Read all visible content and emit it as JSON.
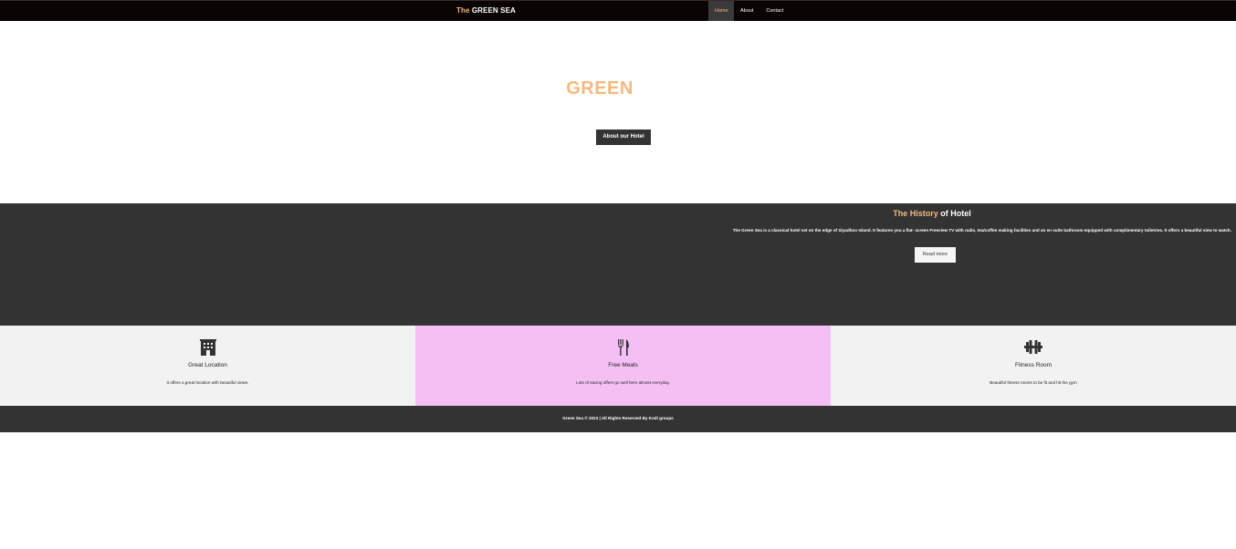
{
  "nav": {
    "brand_prefix": "The",
    "brand_name": "GREEN SEA",
    "links": [
      "Home",
      "About",
      "Contact"
    ]
  },
  "hero": {
    "title": "GREEN",
    "button": "About our Hotel"
  },
  "history": {
    "title_accent": "The History",
    "title_rest": " of Hotel",
    "text": "The Green Sea is a classical hotel set on the edge of Siyadhoo Island. It features you a flat- screen Freeview TV with radio, tea/coffee making facilities and an en suite bathroom equipped with complimentary toiletries. It offers a beautiful view to watch.",
    "button": "Read more"
  },
  "features": [
    {
      "icon": "building-icon",
      "title": "Great Location",
      "desc": "It offers a great location with beautiful views."
    },
    {
      "icon": "utensils-icon",
      "title": "Free Meals",
      "desc": "Lots of saving offers go well here almost everyday."
    },
    {
      "icon": "dumbbell-icon",
      "title": "Fitness Room",
      "desc": "Beautiful fitness rooms to be fit and hit the gym"
    }
  ],
  "footer": {
    "text": "Green Sea © 2023 | All Rights Reserved By Kodi groups"
  },
  "colors": {
    "accent": "#f5b97d",
    "dark": "#333333",
    "navbar": "#0a0404",
    "feature_highlight": "#f4c0f4",
    "feature_bg": "#f2f2f2"
  }
}
